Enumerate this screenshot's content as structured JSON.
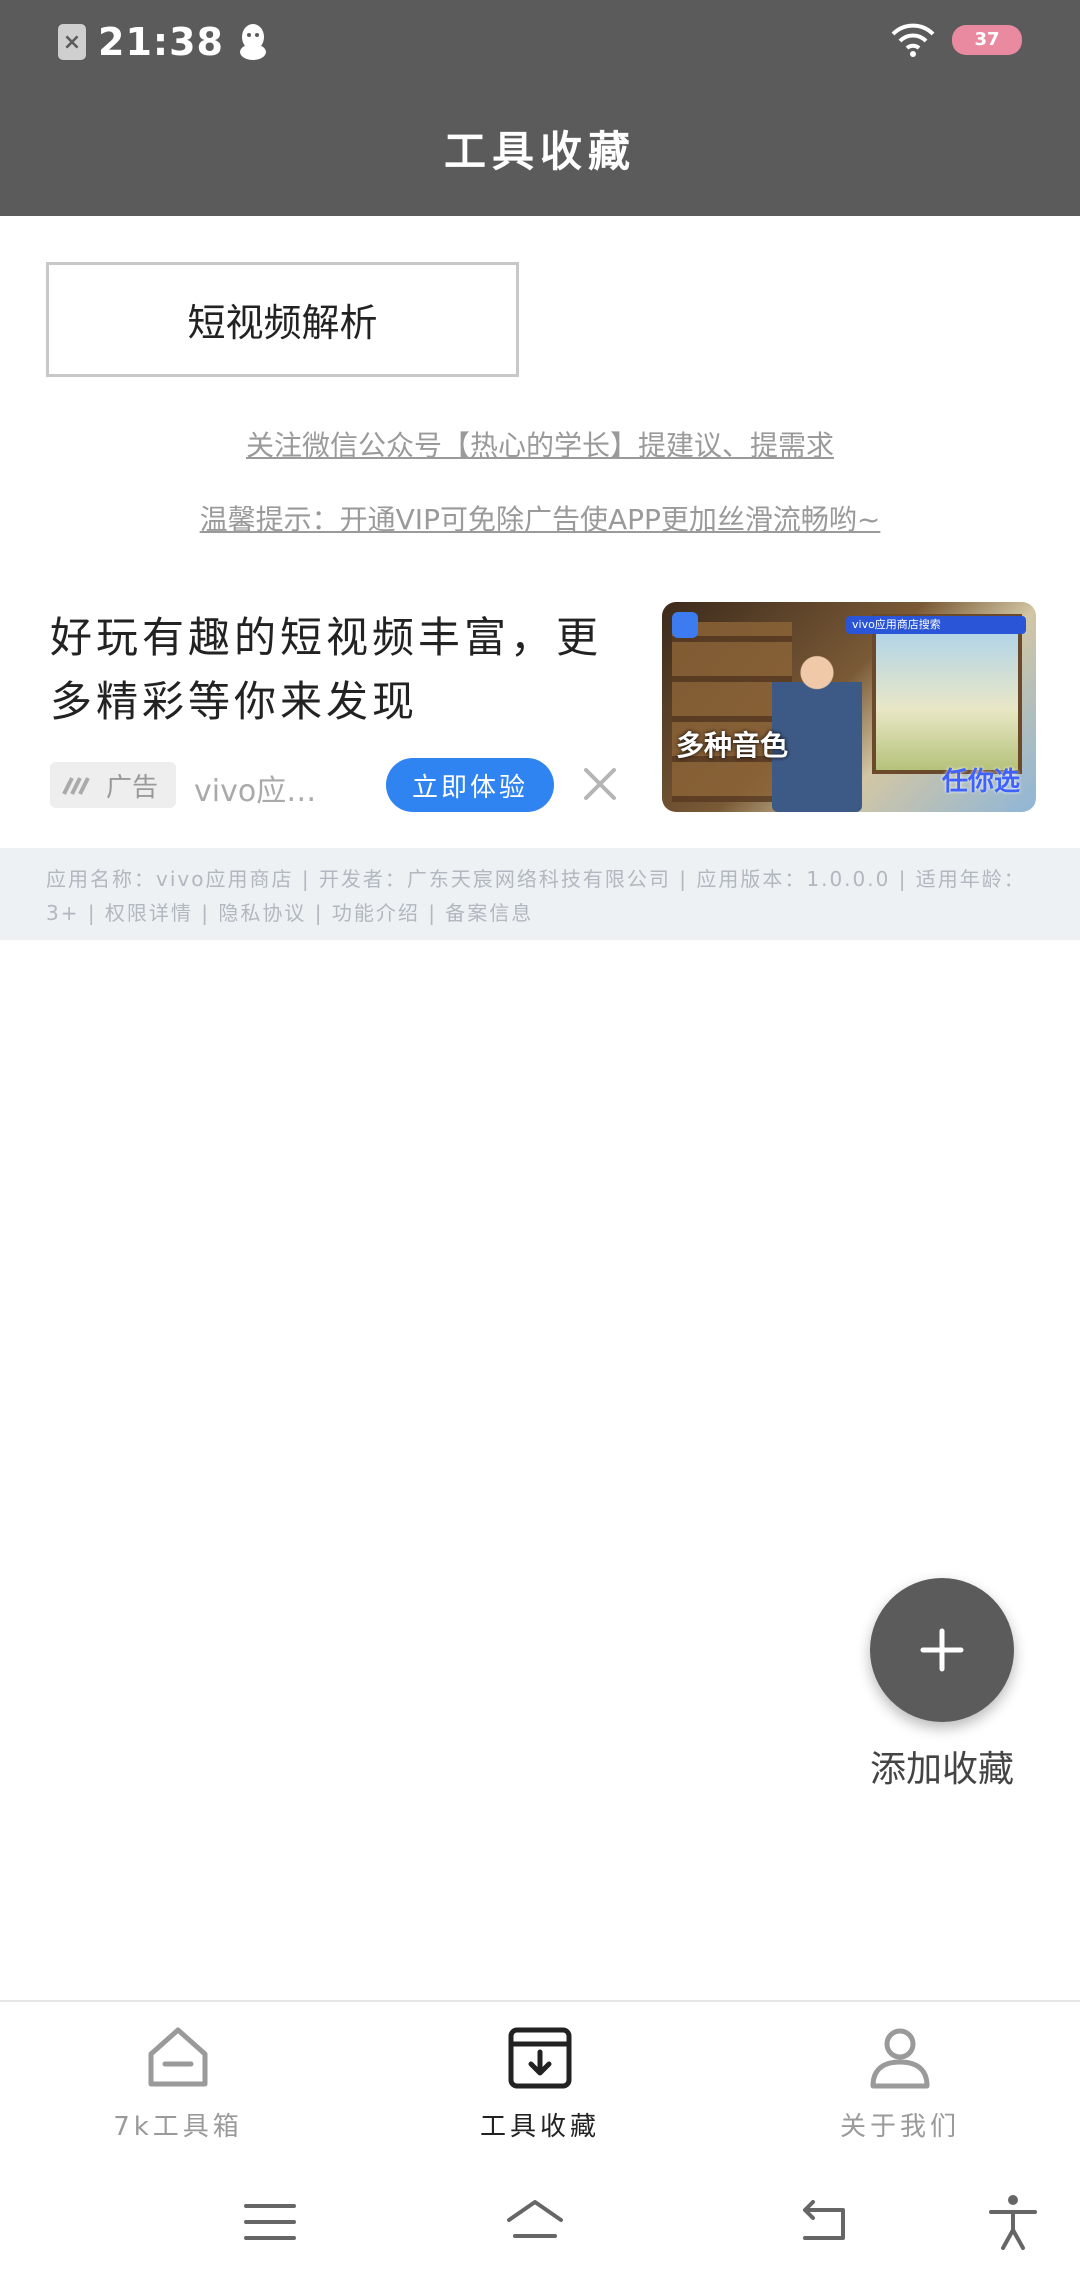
{
  "status_bar": {
    "time": "21:38",
    "battery": "37"
  },
  "header": {
    "title": "工具收藏"
  },
  "tools": [
    {
      "label": "短视频解析"
    }
  ],
  "notices": {
    "wechat": "关注微信公众号【热心的学长】提建议、提需求",
    "vip": "温馨提示：开通VIP可免除广告使APP更加丝滑流畅哟~"
  },
  "ad": {
    "headline": "好玩有趣的短视频丰富，更多精彩等你来发现",
    "badge": "广告",
    "source": "vivo应…",
    "cta": "立即体验",
    "image_title": "多种音色",
    "image_sub": "任你选",
    "image_bar": "vivo应用商店搜索",
    "info": "应用名称：vivo应用商店 | 开发者：广东天宸网络科技有限公司 | 应用版本：1.0.0.0 | 适用年龄：3+ | 权限详情 | 隐私协议 | 功能介绍 | 备案信息"
  },
  "fab": {
    "label": "添加收藏"
  },
  "bottom_nav": {
    "items": [
      {
        "label": "7k工具箱",
        "icon": "home-icon",
        "active": false
      },
      {
        "label": "工具收藏",
        "icon": "archive-download-icon",
        "active": true
      },
      {
        "label": "关于我们",
        "icon": "user-icon",
        "active": false
      }
    ]
  },
  "colors": {
    "header_bg": "#5b5b5b",
    "cta_blue": "#2f84f1",
    "fab_bg": "#5b5b5b"
  }
}
